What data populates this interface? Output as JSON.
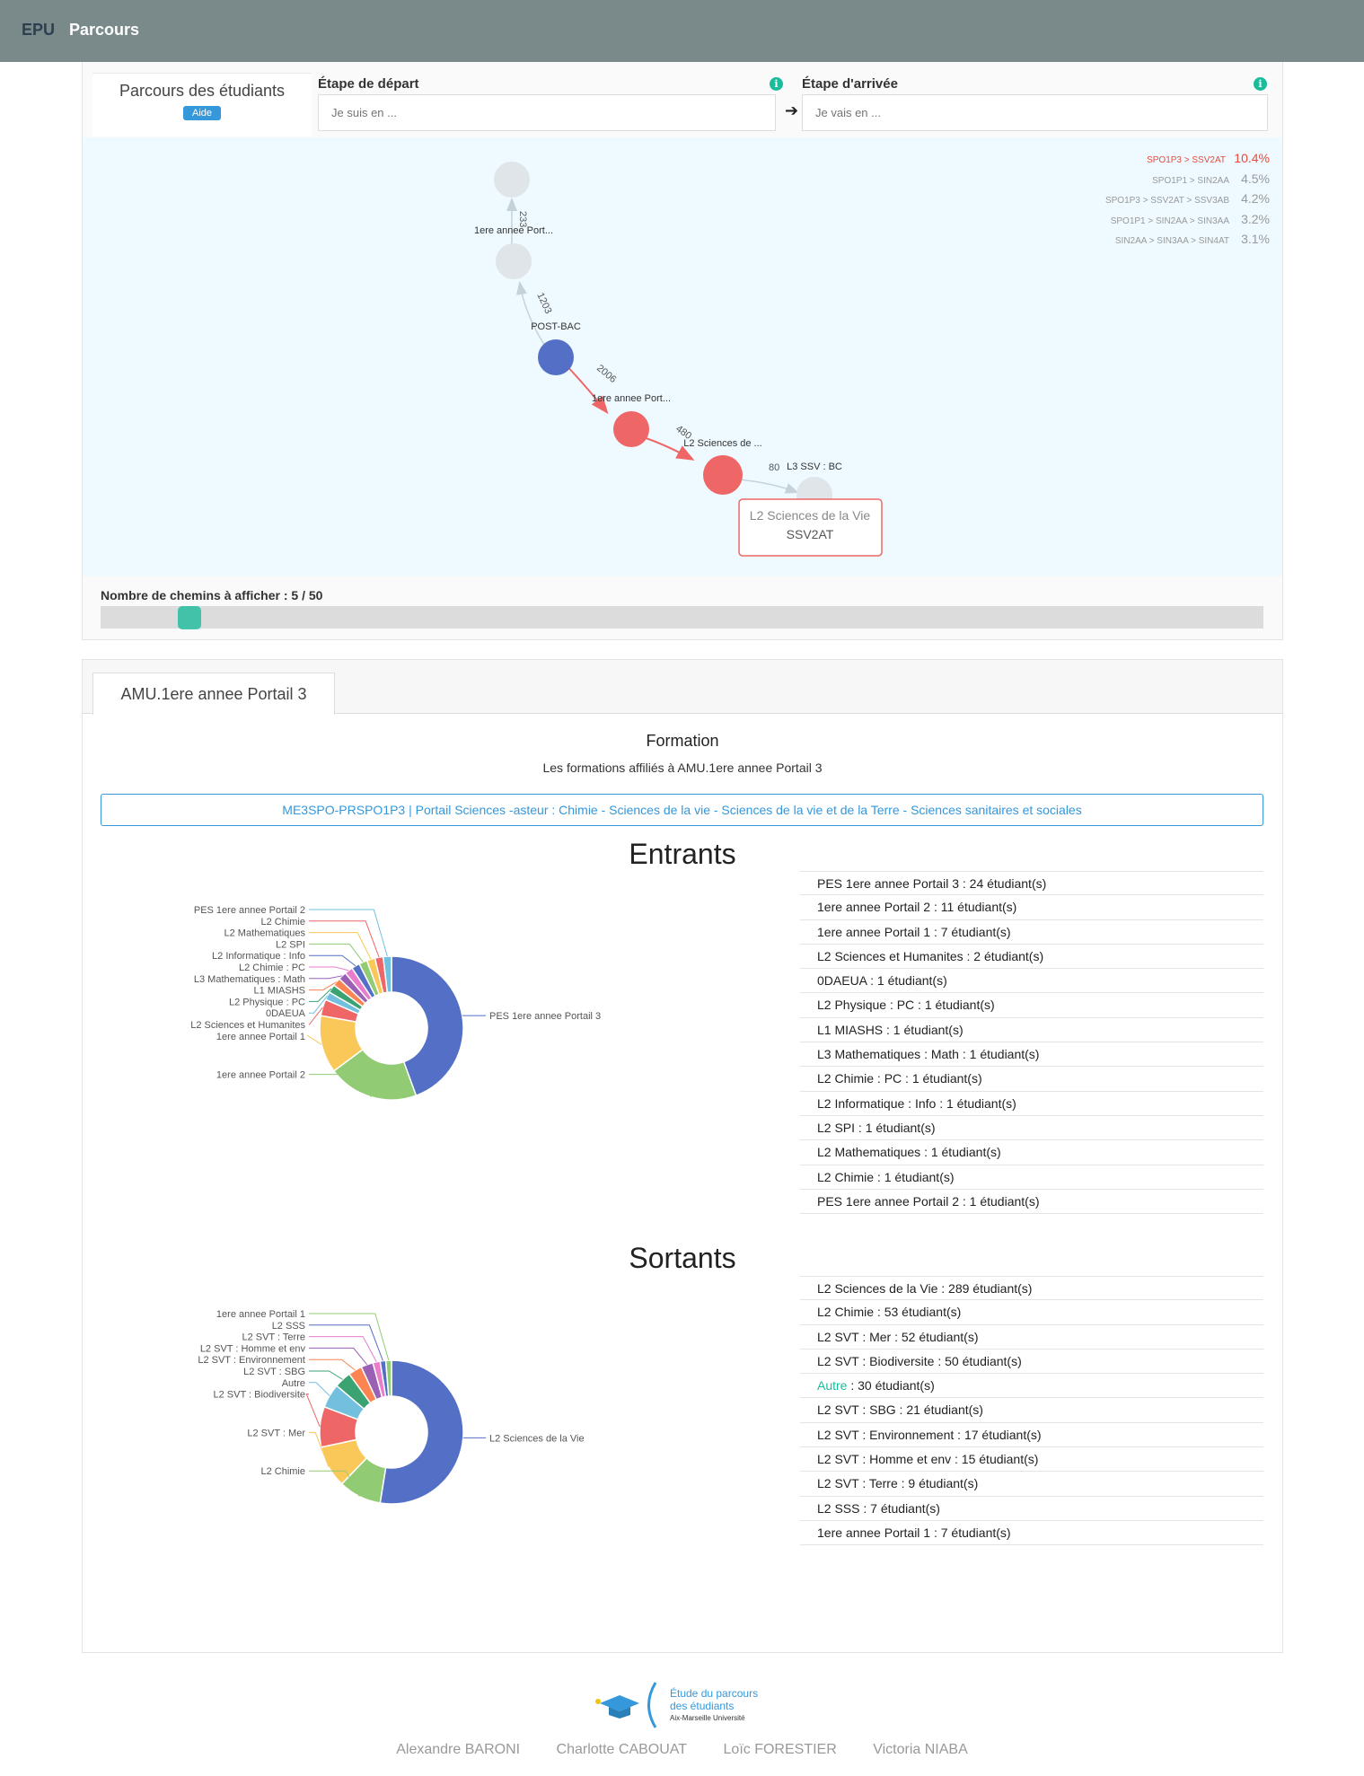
{
  "navbar": {
    "brand": "EPU",
    "link": "Parcours"
  },
  "search": {
    "title": "Parcours des étudiants",
    "help_label": "Aide",
    "start_label": "Étape de départ",
    "start_placeholder": "Je suis en ...",
    "end_label": "Étape d'arrivée",
    "end_placeholder": "Je vais en ...",
    "arrow": "➔",
    "info_glyph": "i"
  },
  "graph": {
    "nodes": [
      {
        "id": "top",
        "label": "",
        "color": "#dfe5e8"
      },
      {
        "id": "n1",
        "label": "1ere annee Port...",
        "color": "#dfe5e8"
      },
      {
        "id": "postbac",
        "label": "POST-BAC",
        "color": "#5470c6"
      },
      {
        "id": "n3",
        "label": "1ere annee Port...",
        "color": "#ee6666"
      },
      {
        "id": "n4",
        "label": "L2 Sciences de ...",
        "color": "#ee6666"
      },
      {
        "id": "n5",
        "label": "L3 SSV : BC",
        "color": "#dfe5e8"
      }
    ],
    "edges": [
      {
        "label": "233"
      },
      {
        "label": "1203"
      },
      {
        "label": "2006"
      },
      {
        "label": "480"
      },
      {
        "label": "80"
      }
    ],
    "tooltip": {
      "line1": "L2 Sciences de la Vie",
      "line2": "SSV2AT"
    },
    "legend": [
      {
        "path": "SPO1P3 > SSV2AT",
        "pct": "10.4%",
        "highlight": true
      },
      {
        "path": "SPO1P1 > SIN2AA",
        "pct": "4.5%",
        "highlight": false
      },
      {
        "path": "SPO1P3 > SSV2AT > SSV3AB",
        "pct": "4.2%",
        "highlight": false
      },
      {
        "path": "SPO1P1 > SIN2AA > SIN3AA",
        "pct": "3.2%",
        "highlight": false
      },
      {
        "path": "SIN2AA > SIN3AA > SIN4AT",
        "pct": "3.1%",
        "highlight": false
      }
    ]
  },
  "slider": {
    "label": "Nombre de chemins à afficher : 5 / 50",
    "value": 5,
    "max": 50
  },
  "detail": {
    "tab": "AMU.1ere annee Portail 3",
    "formation_title": "Formation",
    "formation_sub": "Les formations affiliés à AMU.1ere annee Portail 3",
    "formation_item": "ME3SPO-PRSPO1P3 | Portail Sciences -asteur : Chimie - Sciences de la vie - Sciences de la vie et de la Terre - Sciences sanitaires et sociales",
    "entrants_title": "Entrants",
    "sortants_title": "Sortants",
    "entrants_list": [
      "PES 1ere annee Portail 3 : 24 étudiant(s)",
      "1ere annee Portail 2 : 11 étudiant(s)",
      "1ere annee Portail 1 : 7 étudiant(s)",
      "L2 Sciences et Humanites : 2 étudiant(s)",
      "0DAEUA : 1 étudiant(s)",
      "L2 Physique : PC : 1 étudiant(s)",
      "L1 MIASHS : 1 étudiant(s)",
      "L3 Mathematiques : Math : 1 étudiant(s)",
      "L2 Chimie : PC : 1 étudiant(s)",
      "L2 Informatique : Info : 1 étudiant(s)",
      "L2 SPI : 1 étudiant(s)",
      "L2 Mathematiques : 1 étudiant(s)",
      "L2 Chimie : 1 étudiant(s)",
      "PES 1ere annee Portail 2 : 1 étudiant(s)"
    ],
    "sortants_list": [
      "L2 Sciences de la Vie : 289 étudiant(s)",
      "L2 Chimie : 53 étudiant(s)",
      "L2 SVT : Mer : 52 étudiant(s)",
      "L2 SVT : Biodiversite : 50 étudiant(s)",
      "Autre : 30 étudiant(s)",
      "L2 SVT : SBG : 21 étudiant(s)",
      "L2 SVT : Environnement : 17 étudiant(s)",
      "L2 SVT : Homme et env : 15 étudiant(s)",
      "L2 SVT : Terre : 9 étudiant(s)",
      "L2 SSS : 7 étudiant(s)",
      "1ere annee Portail 1 : 7 étudiant(s)"
    ]
  },
  "chart_data": [
    {
      "type": "pie",
      "title": "Entrants",
      "categories": [
        "PES 1ere annee Portail 3",
        "1ere annee Portail 2",
        "1ere annee Portail 1",
        "L2 Sciences et Humanites",
        "0DAEUA",
        "L2 Physique : PC",
        "L1 MIASHS",
        "L3 Mathematiques : Math",
        "L2 Chimie : PC",
        "L2 Informatique : Info",
        "L2 SPI",
        "L2 Mathematiques",
        "L2 Chimie",
        "PES 1ere annee Portail 2"
      ],
      "values": [
        24,
        11,
        7,
        2,
        1,
        1,
        1,
        1,
        1,
        1,
        1,
        1,
        1,
        1
      ],
      "colors": [
        "#5470c6",
        "#91cc75",
        "#fac858",
        "#ee6666",
        "#73c0de",
        "#3ba272",
        "#fc8452",
        "#9a60b4",
        "#ea7ccc",
        "#5470c6",
        "#91cc75",
        "#fac858",
        "#ee6666",
        "#73c0de"
      ]
    },
    {
      "type": "pie",
      "title": "Sortants",
      "categories": [
        "L2 Sciences de la Vie",
        "L2 Chimie",
        "L2 SVT : Mer",
        "L2 SVT : Biodiversite",
        "Autre",
        "L2 SVT : SBG",
        "L2 SVT : Environnement",
        "L2 SVT : Homme et env",
        "L2 SVT : Terre",
        "L2 SSS",
        "1ere annee Portail 1"
      ],
      "values": [
        289,
        53,
        52,
        50,
        30,
        21,
        17,
        15,
        9,
        7,
        7
      ],
      "colors": [
        "#5470c6",
        "#91cc75",
        "#fac858",
        "#ee6666",
        "#73c0de",
        "#3ba272",
        "#fc8452",
        "#9a60b4",
        "#ea7ccc",
        "#5470c6",
        "#91cc75"
      ]
    }
  ],
  "footer": {
    "logo_line1": "Étude du parcours",
    "logo_line2": "des étudiants",
    "logo_line3": "Aix-Marseille Université",
    "authors": [
      "Alexandre BARONI",
      "Charlotte CABOUAT",
      "Loïc FORESTIER",
      "Victoria NIABA"
    ]
  }
}
